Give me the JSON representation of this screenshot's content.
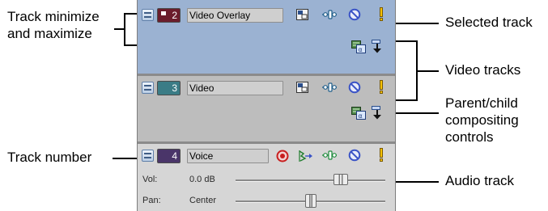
{
  "callouts": {
    "minmax_line1": "Track minimize",
    "minmax_line2": "and maximize",
    "selected_track": "Selected track",
    "video_tracks": "Video tracks",
    "parent_child_line1": "Parent/child",
    "parent_child_line2": "compositing",
    "parent_child_line3": "controls",
    "track_number": "Track number",
    "audio_track": "Audio track"
  },
  "tracks": [
    {
      "number": "2",
      "name": "Video Overlay",
      "kind": "video",
      "selected": true,
      "color": "#6b1d2c"
    },
    {
      "number": "3",
      "name": "Video",
      "kind": "video",
      "selected": false,
      "color": "#3b7c86"
    },
    {
      "number": "4",
      "name": "Voice",
      "kind": "audio",
      "selected": false,
      "color": "#4a3569"
    }
  ],
  "audio_controls": {
    "vol_label": "Vol:",
    "vol_value": "0.0 dB",
    "vol_level": 0.7,
    "pan_label": "Pan:",
    "pan_value": "Center",
    "pan_level": 0.5
  },
  "icons": {
    "track_motion": "track-motion-icon",
    "fx": "track-fx-icon",
    "mute": "mute-icon",
    "solo": "solo-icon",
    "arm_record": "arm-record-icon",
    "automation": "automation-icon",
    "compositing_mode": "compositing-mode-icon",
    "make_compositing_child": "make-compositing-child-icon"
  }
}
